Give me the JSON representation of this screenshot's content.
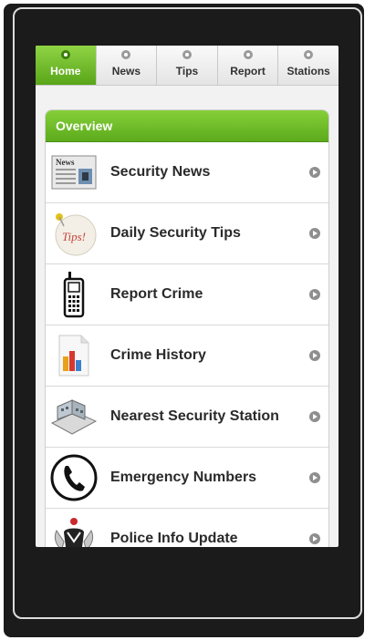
{
  "tabs": [
    {
      "label": "Home",
      "icon": "home-icon",
      "active": true
    },
    {
      "label": "News",
      "icon": "news-icon",
      "active": false
    },
    {
      "label": "Tips",
      "icon": "tips-icon",
      "active": false
    },
    {
      "label": "Report",
      "icon": "report-icon",
      "active": false
    },
    {
      "label": "Stations",
      "icon": "stations-icon",
      "active": false
    }
  ],
  "overview": {
    "title": "Overview",
    "items": [
      {
        "label": "Security News",
        "icon": "newspaper-icon"
      },
      {
        "label": "Daily Security Tips",
        "icon": "tips-badge-icon",
        "icon_text": "Tips!"
      },
      {
        "label": "Report Crime",
        "icon": "mobile-phone-icon"
      },
      {
        "label": "Crime History",
        "icon": "bar-chart-document-icon"
      },
      {
        "label": "Nearest Security Station",
        "icon": "building-icon"
      },
      {
        "label": "Emergency Numbers",
        "icon": "telephone-handset-icon"
      },
      {
        "label": "Police Info Update",
        "icon": "coat-of-arms-icon"
      }
    ]
  },
  "colors": {
    "accent_green": "#6dbb28",
    "frame": "#1b1b1b"
  }
}
